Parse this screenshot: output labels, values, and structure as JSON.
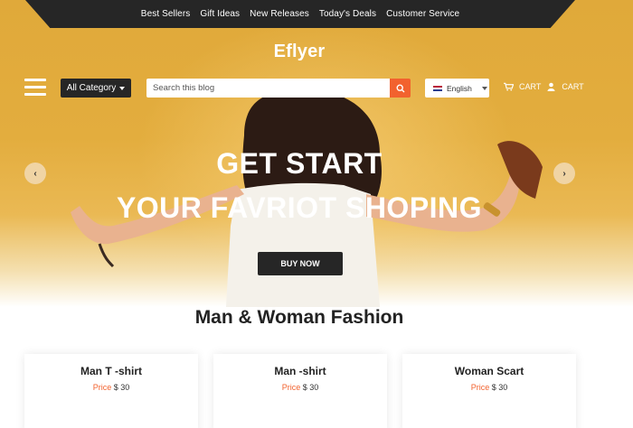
{
  "nav": {
    "links": [
      "Best Sellers",
      "Gift Ideas",
      "New Releases",
      "Today's Deals",
      "Customer Service"
    ]
  },
  "brand": {
    "logo_text": "Eflyer"
  },
  "toolbar": {
    "category_label": "All Category",
    "search_placeholder": "Search this blog",
    "language": "English",
    "cart_label_1": "CART",
    "cart_label_2": "CART"
  },
  "hero": {
    "title_line1": "GET START",
    "title_line2": "YOUR FAVRIOT SHOPING",
    "cta_label": "BUY NOW",
    "prev_symbol": "‹",
    "next_symbol": "›"
  },
  "section": {
    "title": "Man & Woman Fashion",
    "products": [
      {
        "name": "Man T -shirt",
        "price_label": "Price",
        "price_value": "$ 30"
      },
      {
        "name": "Man -shirt",
        "price_label": "Price",
        "price_value": "$ 30"
      },
      {
        "name": "Woman Scart",
        "price_label": "Price",
        "price_value": "$ 30"
      }
    ]
  },
  "colors": {
    "hero_bg": "#e3ad3e",
    "dark": "#262626",
    "accent": "#f2622e"
  },
  "icons": [
    "hamburger-icon",
    "search-icon",
    "flag-icon",
    "cart-icon",
    "user-icon",
    "chevron-left-icon",
    "chevron-right-icon"
  ]
}
